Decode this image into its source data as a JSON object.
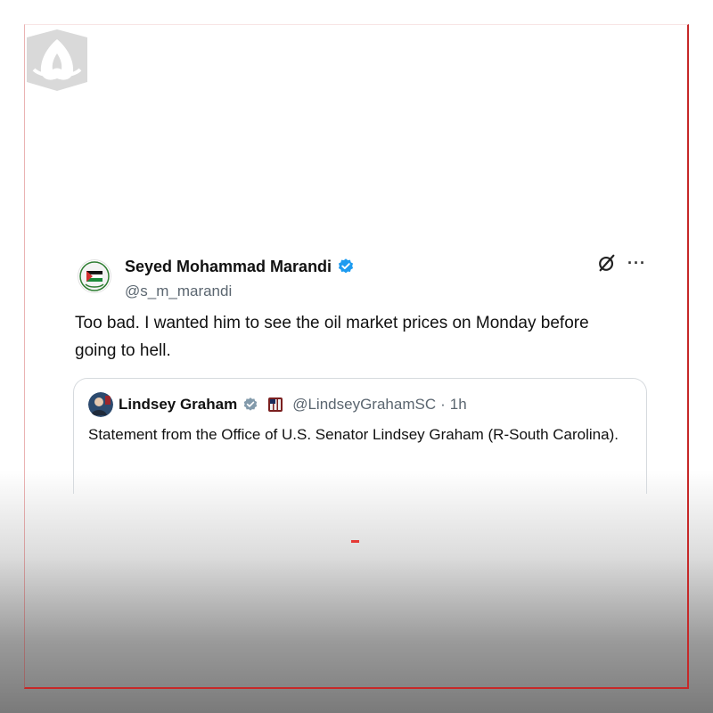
{
  "colors": {
    "frame": "#c62828",
    "verified_blue": "#1d9bf0",
    "government_gray": "#829aab",
    "text": "#111111",
    "muted": "#5b6670"
  },
  "icons": {
    "logo": "stylized-logo-icon",
    "avatar": "palestinian-flag-emblem-icon",
    "verified": "blue-verified-badge-icon",
    "grok": "grok-icon",
    "more": "more-options-icon",
    "quote_badge": "gray-government-badge-icon",
    "quote_flag": "us-senate-flag-icon"
  },
  "tweet": {
    "display_name": "Seyed Mohammad Marandi",
    "handle": "@s_m_marandi",
    "text": "Too bad. I wanted him to see the oil market prices on Monday before going to hell.",
    "more_label": "···"
  },
  "quoted": {
    "display_name": "Lindsey Graham",
    "handle": "@LindseyGrahamSC",
    "separator": "·",
    "time": "1h",
    "text": "Statement from the Office of U.S. Senator Lindsey Graham (R-South Carolina)."
  }
}
